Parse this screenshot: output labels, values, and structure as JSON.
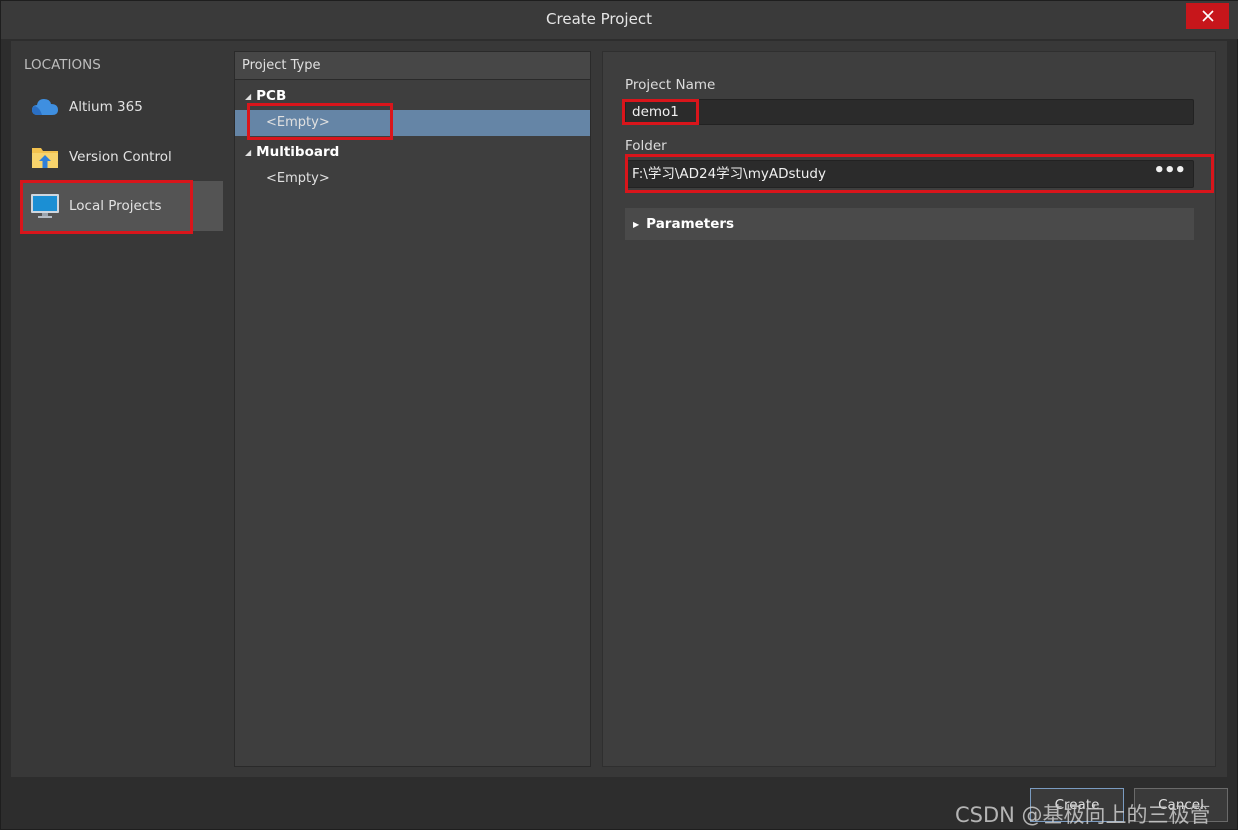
{
  "window": {
    "title": "Create Project"
  },
  "locations": {
    "header": "LOCATIONS",
    "items": [
      {
        "label": "Altium 365",
        "icon": "cloud-icon"
      },
      {
        "label": "Version Control",
        "icon": "folder-upload-icon"
      },
      {
        "label": "Local Projects",
        "icon": "monitor-icon",
        "selected": true
      }
    ]
  },
  "project_type": {
    "header": "Project Type",
    "groups": [
      {
        "label": "PCB",
        "items": [
          {
            "label": "<Empty>",
            "selected": true
          }
        ]
      },
      {
        "label": "Multiboard",
        "items": [
          {
            "label": "<Empty>",
            "selected": false
          }
        ]
      }
    ]
  },
  "form": {
    "name_label": "Project Name",
    "name_value": "demo1",
    "folder_label": "Folder",
    "folder_value": "F:\\学习\\AD24学习\\myADstudy",
    "browse_label": "•••",
    "parameters_label": "Parameters"
  },
  "buttons": {
    "create": "Create",
    "cancel": "Cancel"
  },
  "watermark": "CSDN @基极向上的三极管",
  "colors": {
    "highlight": "#d9151b",
    "selection": "#6585a6",
    "close": "#c7161b"
  }
}
